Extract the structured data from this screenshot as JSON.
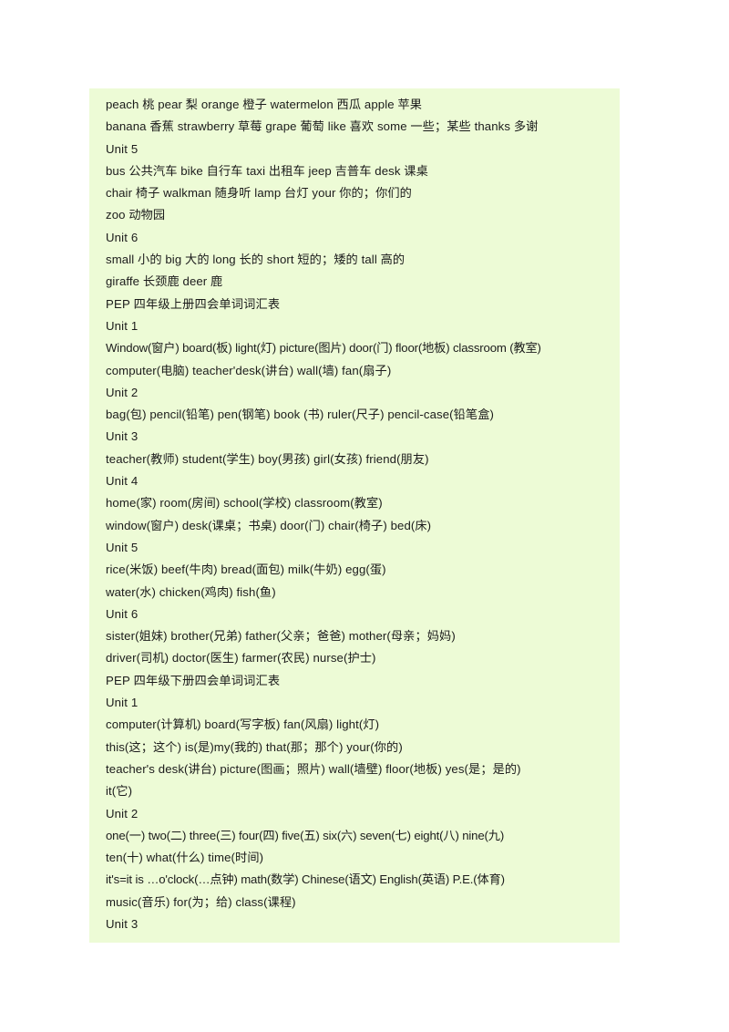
{
  "document": {
    "background_color": "#edfbd6",
    "page_color": "#ffffff",
    "text_color": "#1b1b1b",
    "lines": [
      {
        "text": "peach  桃 pear  梨 orange  橙子 watermelon   西瓜 apple  苹果",
        "kind": "entry"
      },
      {
        "text": "banana  香蕉 strawberry  草莓 grape  葡萄 like  喜欢 some  一些；某些 thanks  多谢",
        "kind": "entry"
      },
      {
        "text": "Unit 5",
        "kind": "unit"
      },
      {
        "text": "bus  公共汽车 bike  自行车 taxi  出租车 jeep  吉普车 desk  课桌",
        "kind": "entry"
      },
      {
        "text": "chair  椅子 walkman  随身听 lamp  台灯 your  你的；你们的",
        "kind": "entry"
      },
      {
        "text": "zoo  动物园",
        "kind": "entry"
      },
      {
        "text": "Unit 6",
        "kind": "unit"
      },
      {
        "text": "small  小的 big  大的 long  长的 short  短的；矮的 tall  高的",
        "kind": "entry"
      },
      {
        "text": "giraffe  长颈鹿 deer  鹿",
        "kind": "entry"
      },
      {
        "text": "PEP 四年级上册四会单词词汇表",
        "kind": "heading"
      },
      {
        "text": "Unit 1",
        "kind": "unit"
      },
      {
        "text": "Window(窗户)   board(板)   light(灯) picture(图片) door(门) floor(地板)   classroom (教室)",
        "kind": "entry-tight"
      },
      {
        "text": "computer(电脑)   teacher'desk(讲台)   wall(墙)   fan(扇子)",
        "kind": "entry"
      },
      {
        "text": "Unit 2",
        "kind": "unit"
      },
      {
        "text": "bag(包)   pencil(铅笔)   pen(钢笔)   book (书)   ruler(尺子) pencil-case(铅笔盒)",
        "kind": "entry"
      },
      {
        "text": "Unit 3",
        "kind": "unit"
      },
      {
        "text": "teacher(教师)    student(学生)    boy(男孩)    girl(女孩)   friend(朋友)",
        "kind": "entry"
      },
      {
        "text": "Unit 4",
        "kind": "unit"
      },
      {
        "text": "home(家)    room(房间)    school(学校)   classroom(教室)",
        "kind": "entry"
      },
      {
        "text": "window(窗户)   desk(课桌；书桌)   door(门)   chair(椅子)   bed(床)",
        "kind": "entry"
      },
      {
        "text": "Unit 5",
        "kind": "unit"
      },
      {
        "text": "rice(米饭)   beef(牛肉)   bread(面包)   milk(牛奶)   egg(蛋)",
        "kind": "entry"
      },
      {
        "text": "water(水)   chicken(鸡肉)   fish(鱼)",
        "kind": "entry"
      },
      {
        "text": "Unit 6",
        "kind": "unit"
      },
      {
        "text": "sister(姐妹)   brother(兄弟)   father(父亲；爸爸)   mother(母亲；妈妈)",
        "kind": "entry"
      },
      {
        "text": "driver(司机)   doctor(医生)    farmer(农民)   nurse(护士)",
        "kind": "entry"
      },
      {
        "text": "PEP 四年级下册四会单词词汇表",
        "kind": "heading"
      },
      {
        "text": "Unit 1",
        "kind": "unit"
      },
      {
        "text": "computer(计算机)   board(写字板)   fan(风扇)   light(灯)",
        "kind": "entry"
      },
      {
        "text": "this(这；这个)   is(是)my(我的)   that(那；那个)   your(你的)",
        "kind": "entry"
      },
      {
        "text": "teacher's desk(讲台)   picture(图画；照片)   wall(墙壁)   floor(地板)   yes(是；是的)",
        "kind": "entry"
      },
      {
        "text": "it(它)",
        "kind": "entry"
      },
      {
        "text": "Unit 2",
        "kind": "unit"
      },
      {
        "text": "one(一)   two(二)   three(三)   four(四)   five(五)   six(六)   seven(七)   eight(八)   nine(九)",
        "kind": "entry-tight"
      },
      {
        "text": "ten(十)   what(什么)   time(时间)",
        "kind": "entry"
      },
      {
        "text": "it's=it is      …o'clock(…点钟)     math(数学)   Chinese(语文)   English(英语)   P.E.(体育)",
        "kind": "entry-tight"
      },
      {
        "text": "music(音乐)   for(为；给)   class(课程)",
        "kind": "entry"
      },
      {
        "text": "Unit 3",
        "kind": "unit"
      }
    ]
  }
}
